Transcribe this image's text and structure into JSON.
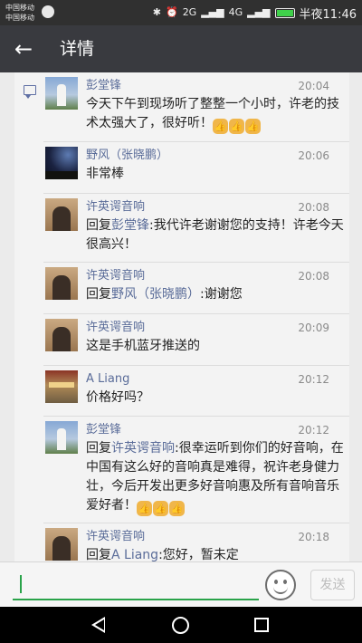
{
  "status_bar": {
    "carrier_top": "中国移动",
    "carrier_bottom": "中国移动",
    "network_1": "2G",
    "network_2": "4G",
    "time": "半夜11:46",
    "icons": [
      "bluetooth-icon",
      "alarm-icon",
      "signal-icon",
      "battery-icon"
    ]
  },
  "app_bar": {
    "back_icon": "back-arrow-icon",
    "title": "详情"
  },
  "comments": [
    {
      "name": "彭堂锋",
      "time": "20:04",
      "avatar": "avatar-pengtangfeng",
      "text": "今天下午到现场听了整整一个小时，许老的技术太强大了，很好听！",
      "emoji": [
        "👍",
        "👍",
        "👍"
      ]
    },
    {
      "name": "野风（张晓鹏）",
      "time": "20:06",
      "avatar": "avatar-yefeng",
      "text": "非常棒",
      "emoji": []
    },
    {
      "name": "许英谔音响",
      "time": "20:08",
      "avatar": "avatar-xuyinge",
      "reply_prefix": "回复",
      "reply_to": "彭堂锋",
      "text": ":我代许老谢谢您的支持！许老今天很高兴！",
      "emoji": []
    },
    {
      "name": "许英谔音响",
      "time": "20:08",
      "avatar": "avatar-xuyinge",
      "reply_prefix": "回复",
      "reply_to": "野风（张晓鹏）",
      "text": ":谢谢您",
      "emoji": []
    },
    {
      "name": "许英谔音响",
      "time": "20:09",
      "avatar": "avatar-xuyinge",
      "text": "这是手机蓝牙推送的",
      "emoji": []
    },
    {
      "name": "A Liang",
      "time": "20:12",
      "avatar": "avatar-aliang",
      "text": "价格好吗？",
      "emoji": []
    },
    {
      "name": "彭堂锋",
      "time": "20:12",
      "avatar": "avatar-pengtangfeng",
      "reply_prefix": "回复",
      "reply_to": "许英谔音响",
      "text": ":很幸运听到你们的好音响，在中国有这么好的音响真是难得，祝许老身健力壮，今后开发出更多好音响惠及所有音响音乐爱好者！",
      "emoji": [
        "👍",
        "👍",
        "👍"
      ]
    },
    {
      "name": "许英谔音响",
      "time": "20:18",
      "avatar": "avatar-xuyinge",
      "reply_prefix": "回复",
      "reply_to": "A Liang",
      "text": ":您好，暂未定",
      "emoji": []
    }
  ],
  "input_bar": {
    "value": "",
    "placeholder": "",
    "emoji_icon": "smiley-icon",
    "send_label": "发送"
  },
  "nav_bar": {
    "icons": [
      "nav-back-icon",
      "nav-home-icon",
      "nav-recent-icon"
    ]
  },
  "colors": {
    "app_bar": "#393a3f",
    "name_link": "#5a6c99",
    "accent_green": "#2aa34a",
    "status_bar": "#303030"
  }
}
